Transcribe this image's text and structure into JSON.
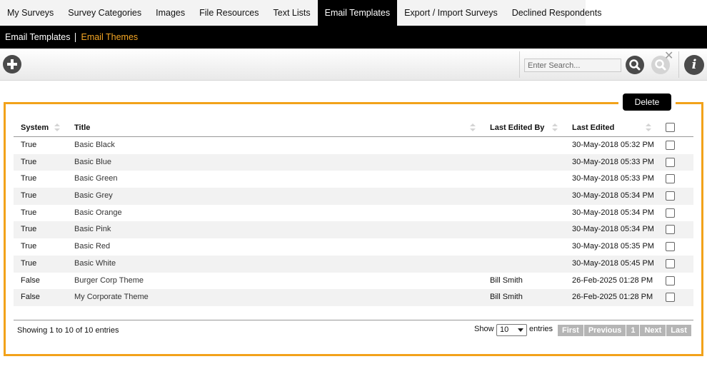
{
  "top_tabs": [
    {
      "label": "My Surveys",
      "active": false
    },
    {
      "label": "Survey Categories",
      "active": false
    },
    {
      "label": "Images",
      "active": false
    },
    {
      "label": "File Resources",
      "active": false
    },
    {
      "label": "Text Lists",
      "active": false
    },
    {
      "label": "Email Templates",
      "active": true
    },
    {
      "label": "Export / Import Surveys",
      "active": false
    },
    {
      "label": "Declined Respondents",
      "active": false
    }
  ],
  "subnav": {
    "templates_label": "Email Templates",
    "themes_label": "Email Themes"
  },
  "toolbar": {
    "add_icon": "plus-circle-icon",
    "search_placeholder": "Enter Search...",
    "search_icon": "search-icon",
    "clear_search_icon": "clear-search-icon",
    "info_icon": "info-icon",
    "info_glyph": "i",
    "clear_glyph": "✕"
  },
  "delete_label": "Delete",
  "table": {
    "headers": {
      "system": "System",
      "title": "Title",
      "last_edited_by": "Last Edited By",
      "last_edited": "Last Edited"
    },
    "rows": [
      {
        "system": "True",
        "title": "Basic Black",
        "last_edited_by": "",
        "last_edited": "30-May-2018 05:32 PM"
      },
      {
        "system": "True",
        "title": "Basic Blue",
        "last_edited_by": "",
        "last_edited": "30-May-2018 05:33 PM"
      },
      {
        "system": "True",
        "title": "Basic Green",
        "last_edited_by": "",
        "last_edited": "30-May-2018 05:33 PM"
      },
      {
        "system": "True",
        "title": "Basic Grey",
        "last_edited_by": "",
        "last_edited": "30-May-2018 05:34 PM"
      },
      {
        "system": "True",
        "title": "Basic Orange",
        "last_edited_by": "",
        "last_edited": "30-May-2018 05:34 PM"
      },
      {
        "system": "True",
        "title": "Basic Pink",
        "last_edited_by": "",
        "last_edited": "30-May-2018 05:34 PM"
      },
      {
        "system": "True",
        "title": "Basic Red",
        "last_edited_by": "",
        "last_edited": "30-May-2018 05:35 PM"
      },
      {
        "system": "True",
        "title": "Basic White",
        "last_edited_by": "",
        "last_edited": "30-May-2018 05:45 PM"
      },
      {
        "system": "False",
        "title": "Burger Corp Theme",
        "last_edited_by": "Bill Smith",
        "last_edited": "26-Feb-2025 01:28 PM"
      },
      {
        "system": "False",
        "title": "My Corporate Theme",
        "last_edited_by": "Bill Smith",
        "last_edited": "26-Feb-2025 01:28 PM"
      }
    ]
  },
  "footer": {
    "info": "Showing 1 to 10 of 10 entries",
    "show_label": "Show",
    "page_size": "10",
    "entries_label": "entries",
    "pager": {
      "first": "First",
      "previous": "Previous",
      "current": "1",
      "next": "Next",
      "last": "Last"
    }
  },
  "colors": {
    "accent": "#f2a21a",
    "active_subnav": "#f5a623"
  }
}
